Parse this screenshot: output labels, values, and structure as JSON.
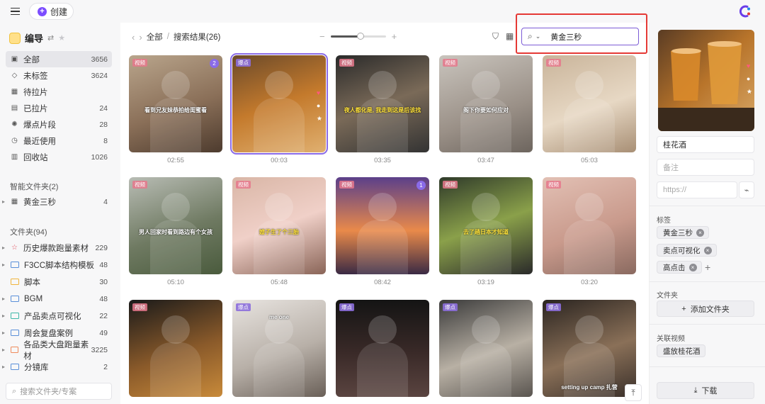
{
  "topbar": {
    "create_label": "创建"
  },
  "sidebar": {
    "library_title": "编导",
    "items": [
      {
        "label": "全部",
        "count": "3656",
        "icon": "inbox-icon",
        "glyph": "▣"
      },
      {
        "label": "未标签",
        "count": "3624",
        "icon": "tag-icon",
        "glyph": "◇"
      },
      {
        "label": "待拉片",
        "count": "",
        "icon": "calendar-icon",
        "glyph": "▦"
      },
      {
        "label": "已拉片",
        "count": "24",
        "icon": "calendar-check-icon",
        "glyph": "▤"
      },
      {
        "label": "爆点片段",
        "count": "28",
        "icon": "sparkle-icon",
        "glyph": "✺"
      },
      {
        "label": "最近使用",
        "count": "8",
        "icon": "clock-icon",
        "glyph": "◷"
      },
      {
        "label": "回收站",
        "count": "1026",
        "icon": "trash-icon",
        "glyph": "▥"
      }
    ],
    "smart_folders_label": "智能文件夹(2)",
    "smart_folders": [
      {
        "label": "黄金三秒",
        "count": "4"
      }
    ],
    "folders_label": "文件夹(94)",
    "folders": [
      {
        "label": "历史爆款跑量素材",
        "count": "229",
        "color": "#e04b5b"
      },
      {
        "label": "F3CC脚本结构模板",
        "count": "48",
        "color": "#5a8fd8"
      },
      {
        "label": "脚本",
        "count": "30",
        "color": "#f0b43c"
      },
      {
        "label": "BGM",
        "count": "48",
        "color": "#5a8fd8"
      },
      {
        "label": "产品卖点可视化",
        "count": "22",
        "color": "#3fb8a8"
      },
      {
        "label": "周会复盘案例",
        "count": "49",
        "color": "#5a8fd8"
      },
      {
        "label": "各品类大盘跑量素材",
        "count": "3225",
        "color": "#ef8a5a"
      },
      {
        "label": "分镜库",
        "count": "2",
        "color": "#5a8fd8"
      }
    ],
    "search_placeholder": "搜索文件夹/专案"
  },
  "main": {
    "breadcrumb_root": "全部",
    "breadcrumb_sep": "/",
    "breadcrumb_current": "搜索结果(26)",
    "zoom_level": 0.55,
    "search_query": "黄金三秒",
    "cards": [
      {
        "tag": "视频",
        "duration": "02:55",
        "caption": "看到兄友妹恭拍给闺蜜看",
        "badge": "2",
        "bg": "linear-gradient(160deg,#b9a58c,#8a6f58 55%,#4d3b2e)"
      },
      {
        "tag": "爆点",
        "duration": "00:03",
        "caption": "",
        "badge": "",
        "bg": "linear-gradient(160deg,#6b4a2a,#c47a2c 50%,#e0b070)"
      },
      {
        "tag": "视频",
        "duration": "03:35",
        "caption": "夜人都化是, 我走到这是后该找",
        "badge": "",
        "bg": "linear-gradient(160deg,#2a2a2a,#7a6a58 50%,#333)"
      },
      {
        "tag": "视频",
        "duration": "03:47",
        "caption": "阁下你要如何应对",
        "badge": "",
        "bg": "linear-gradient(160deg,#c9c4bd,#9a9087 60%,#6d655e)"
      },
      {
        "tag": "视频",
        "duration": "05:03",
        "caption": "",
        "badge": "",
        "bg": "linear-gradient(160deg,#c9b49a,#e7d8c4 55%,#a88f75)"
      },
      {
        "tag": "视频",
        "duration": "05:10",
        "caption": "男人回家时看到路边有个女孩",
        "badge": "",
        "bg": "linear-gradient(160deg,#b8bcb4,#6f7a62 55%,#4a5b3d)"
      },
      {
        "tag": "视频",
        "duration": "05:48",
        "caption": "嫂子生了个三胎",
        "badge": "",
        "bg": "linear-gradient(160deg,#d9b6a6,#f0d0c8 50%,#8a6558)"
      },
      {
        "tag": "视频",
        "duration": "08:42",
        "caption": "",
        "badge": "1",
        "bg": "linear-gradient(180deg,#5b3f8a,#e98a4a 55%,#3a2a44)"
      },
      {
        "tag": "视频",
        "duration": "03:19",
        "caption": "去了趟日本才知道",
        "badge": "",
        "bg": "linear-gradient(160deg,#2f3a2a,#8aa04a 50%,#2a2a2a)"
      },
      {
        "tag": "视频",
        "duration": "03:20",
        "caption": "",
        "badge": "",
        "bg": "linear-gradient(160deg,#e2c0b4,#c99a8c 55%,#8a6a60)"
      },
      {
        "tag": "视频",
        "duration": "",
        "caption": "",
        "badge": "",
        "bg": "linear-gradient(160deg,#1a1a1a,#8a5a2a 55%,#c88a3a)"
      },
      {
        "tag": "爆点",
        "duration": "",
        "caption": "me one",
        "badge": "",
        "bg": "linear-gradient(160deg,#e8e4e0,#b8b0a8 55%,#6a6058)"
      },
      {
        "tag": "爆点",
        "duration": "",
        "caption": "",
        "badge": "",
        "bg": "linear-gradient(180deg,#141414,#3a2a28 55%,#5a4440)"
      },
      {
        "tag": "爆点",
        "duration": "",
        "caption": "",
        "badge": "",
        "bg": "linear-gradient(160deg,#3a3a3a,#b8b0a4 55%,#5a5550)"
      },
      {
        "tag": "爆点",
        "duration": "",
        "caption": "setting up camp 扎营",
        "badge": "",
        "bg": "linear-gradient(160deg,#2a2420,#8a7058 55%,#3a302a)"
      }
    ]
  },
  "detail": {
    "title": "桂花酒",
    "notes_placeholder": "备注",
    "url_placeholder": "https://",
    "tags_label": "标签",
    "tags": [
      "黄金三秒",
      "卖点可视化",
      "高点击"
    ],
    "folder_label": "文件夹",
    "add_folder_label": "添加文件夹",
    "related_label": "关联视频",
    "related": [
      "盛放桂花酒"
    ],
    "download_label": "下载"
  },
  "colors": {
    "accent": "#7c4dff",
    "selection": "#8a6be8",
    "highlight_box": "#e53935"
  }
}
